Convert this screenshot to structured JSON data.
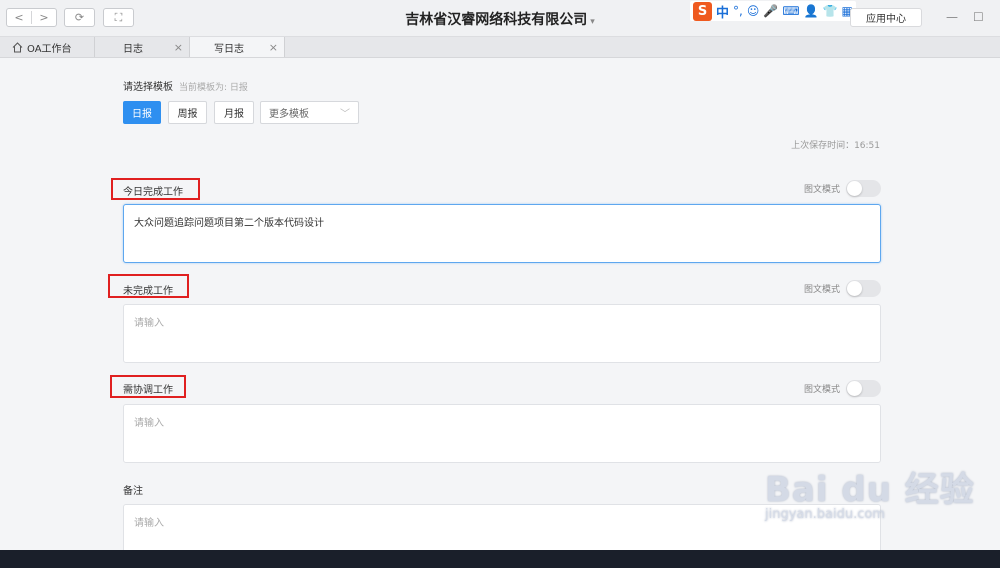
{
  "titlebar": {
    "title": "吉林省汉睿网络科技有限公司",
    "caret": "▾",
    "nav_back": "<",
    "nav_forward": ">",
    "refresh_icon": "⟳",
    "fullscreen_icon": "⛶",
    "ime": {
      "logo": "S",
      "mode": "中",
      "punct": "°,",
      "emoji": "☺",
      "mic": "🎤",
      "keyboard": "⌨",
      "user": "👤",
      "shirt": "👕",
      "grid": "▦"
    },
    "app_center": "应用中心",
    "minimize": "—",
    "maximize": "☐"
  },
  "tabs": [
    {
      "label": "OA工作台",
      "icon": "home-icon"
    },
    {
      "label": "日志",
      "close": "×"
    },
    {
      "label": "写日志",
      "close": "×"
    }
  ],
  "template": {
    "label": "请选择模板",
    "hint": "当前模板为: 日报",
    "buttons": [
      "日报",
      "周报",
      "月报"
    ],
    "more": "更多模板",
    "more_caret": "﹀"
  },
  "last_saved": "上次保存时间：16:51",
  "sections": [
    {
      "label": "今日完成工作",
      "mode": "图文模式",
      "value": "大众问题追踪问题项目第二个版本代码设计",
      "placeholder": ""
    },
    {
      "label": "未完成工作",
      "mode": "图文模式",
      "value": "",
      "placeholder": "请输入"
    },
    {
      "label": "需协调工作",
      "mode": "图文模式",
      "value": "",
      "placeholder": "请输入"
    },
    {
      "label": "备注",
      "value": "",
      "placeholder": "请输入"
    }
  ],
  "watermark": {
    "brand": "Bai du 经验",
    "url": "jingyan.baidu.com"
  },
  "colors": {
    "accent": "#2e8ff0",
    "highlight_box": "#e02020"
  }
}
